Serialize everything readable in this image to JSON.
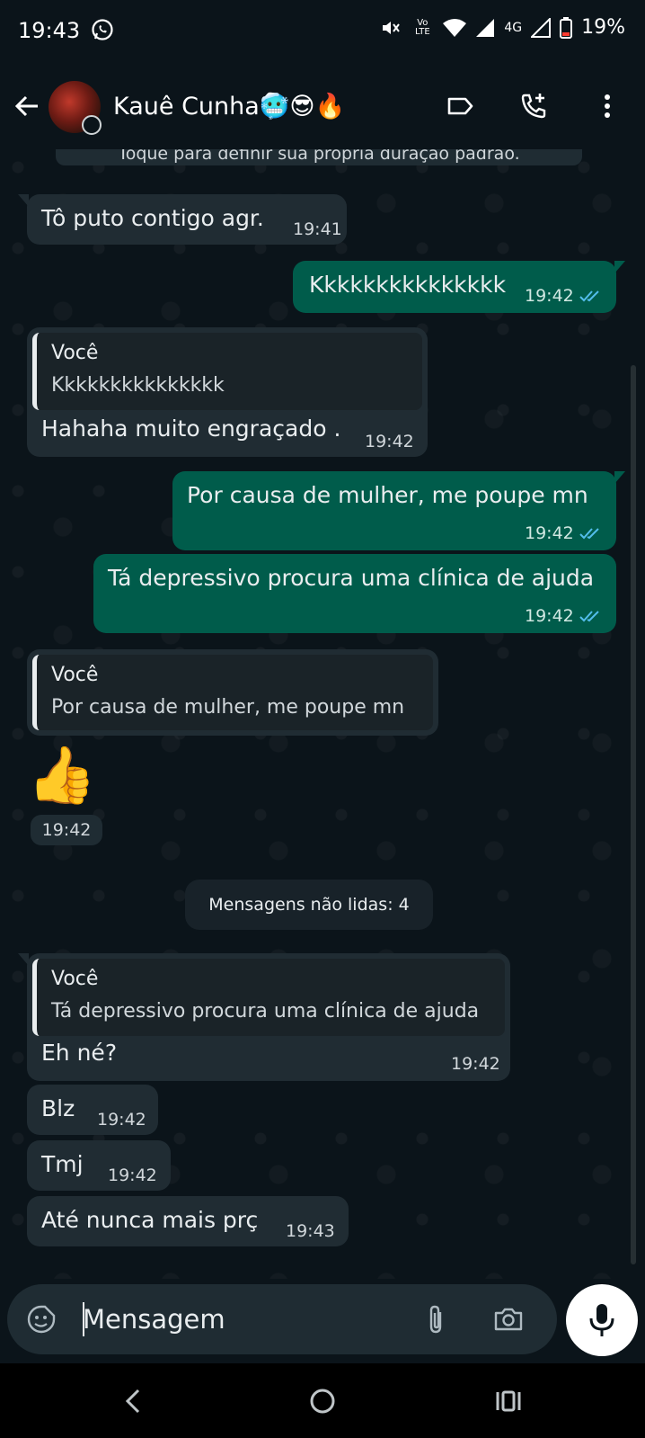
{
  "status_bar": {
    "time": "19:43",
    "network_small": "Vo LTE",
    "network_type": "4G",
    "battery": "19%"
  },
  "header": {
    "contact_name": "Kauê Cunha🥶😎🔥",
    "icons": [
      "back-arrow-icon",
      "label-icon",
      "add-call-icon",
      "more-vert-icon"
    ]
  },
  "chat": {
    "system_banner": "Toque para definir sua própria duração padrão.",
    "messages": [
      {
        "dir": "in",
        "text": "Tô puto contigo agr.",
        "time": "19:41"
      },
      {
        "dir": "out",
        "text": "Kkkkkkkkkkkkkkk",
        "time": "19:42",
        "read": true
      },
      {
        "dir": "in",
        "quote_author": "Você",
        "quote_text": "Kkkkkkkkkkkkkkk",
        "text": "Hahaha muito engraçado .",
        "time": "19:42"
      },
      {
        "dir": "out",
        "text": "Por causa de mulher, me poupe mn",
        "time": "19:42",
        "read": true
      },
      {
        "dir": "out",
        "text": "Tá depressivo procura uma clínica de ajuda",
        "time": "19:42",
        "read": true
      },
      {
        "dir": "in",
        "quote_author": "Você",
        "quote_text": "Por causa de mulher, me poupe mn",
        "text": "👍",
        "time": "19:42"
      },
      {
        "dir": "in",
        "quote_author": "Você",
        "quote_text": "Tá depressivo procura uma clínica de ajuda",
        "text": "Eh né?",
        "time": "19:42"
      },
      {
        "dir": "in",
        "text": "Blz",
        "time": "19:42"
      },
      {
        "dir": "in",
        "text": "Tmj",
        "time": "19:42"
      },
      {
        "dir": "in",
        "text": "Até nunca mais prç",
        "time": "19:43"
      }
    ],
    "unread_divider": "Mensagens não lidas: 4"
  },
  "composer": {
    "placeholder": "Mensagem",
    "icons": [
      "emoji-sticker-icon",
      "attach-icon",
      "camera-icon",
      "mic-icon"
    ]
  },
  "colors": {
    "background": "#0b141a",
    "incoming_bubble": "#202c33",
    "outgoing_bubble": "#005c4b",
    "read_ticks": "#53bdeb"
  }
}
